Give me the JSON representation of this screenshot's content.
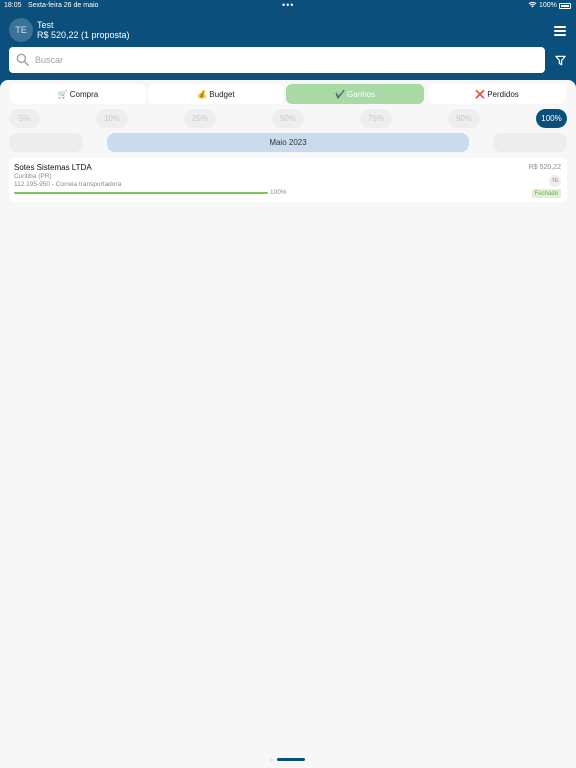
{
  "status_bar": {
    "time": "18:05",
    "date": "Sexta-feira 26 de maio",
    "dots": "•••",
    "battery": "100%"
  },
  "header": {
    "avatar_initials": "TE",
    "user_name": "Test",
    "summary": "R$ 520,22 (1 proposta)"
  },
  "search": {
    "placeholder": "Buscar",
    "value": ""
  },
  "tabs": [
    {
      "label": "Compra",
      "emoji": "🛒"
    },
    {
      "label": "Budget",
      "emoji": "💰"
    },
    {
      "label": "Ganhos",
      "emoji": "✔️"
    },
    {
      "label": "Perdidos",
      "emoji": "❌"
    }
  ],
  "active_tab": "Ganhos",
  "percent_filters": [
    "5%",
    "10%",
    "25%",
    "50%",
    "75%",
    "90%",
    "100%"
  ],
  "active_percent": "100%",
  "months": {
    "current": "Maio 2023"
  },
  "proposals": [
    {
      "company": "Sotes Sistemas LTDA",
      "city": "Curitiba (PR)",
      "address": "112.195-950 - Correia transportadora",
      "progress": 100,
      "progress_label": "100%",
      "value": "R$ 520,22",
      "owner_initials": "TE",
      "status": "Fechado"
    }
  ],
  "colors": {
    "primary": "#0b4f7c",
    "active_tab": "#a9d9a5",
    "progress": "#7fc45b",
    "status_badge_bg": "#dff0d6"
  }
}
